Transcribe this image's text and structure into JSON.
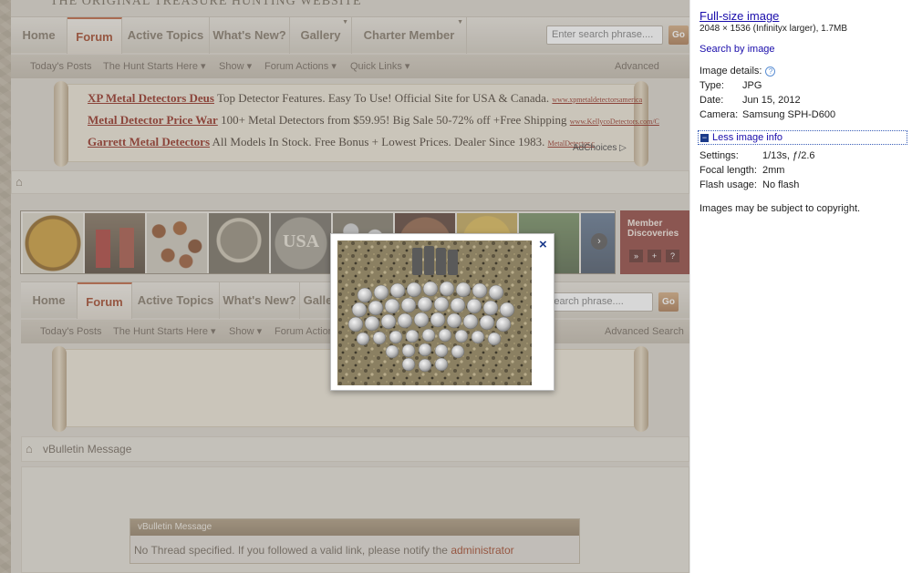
{
  "forum": {
    "tagline": "THE ORIGINAL TREASURE HUNTING WEBSITE",
    "nav_tabs": [
      "Home",
      "Forum",
      "Active Topics",
      "What's New?",
      "Gallery",
      "Charter Member"
    ],
    "nav_tabs_lower": [
      "Home",
      "Forum",
      "Active Topics",
      "What's New?",
      "Galle"
    ],
    "search_placeholder": "Enter search phrase....",
    "search_placeholder_lower": "er search phrase....",
    "go_label": "Go",
    "subnav": [
      "Today's Posts",
      "The Hunt Starts Here ▾",
      "Show ▾",
      "Forum Actions ▾",
      "Quick Links ▾"
    ],
    "subnav_lower": [
      "Today's Posts",
      "The Hunt Starts Here ▾",
      "Show ▾",
      "Forum Action"
    ],
    "advanced_search": "Advanced Search",
    "advanced_search_top": "Advanced Search",
    "ads": [
      {
        "title": "XP Metal Detectors Deus",
        "text": " Top Detector Features. Easy To Use! Official Site for USA & Canada. ",
        "url": "www.xpmetaldetectorsamerica"
      },
      {
        "title": "Metal Detector Price War",
        "text": " 100+ Metal Detectors from $59.95! Big Sale 50-72% off +Free Shipping ",
        "url": "www.KellycoDetectors.com/C"
      },
      {
        "title": "Garrett Metal Detectors",
        "text": " All Models In Stock. Free Bonus + Lowest Prices. Dealer Since 1983. ",
        "url": "MetalDetector.c"
      }
    ],
    "adchoices": "AdChoices ▷",
    "member_box": "Member Discoveries",
    "member_buttons": [
      "»",
      "+",
      "?"
    ],
    "strip_arrow": "›",
    "message_title": "vBulletin Message",
    "message_panel_title": "vBulletin Message",
    "message_text": "No Thread specified. If you followed a valid link, please notify the ",
    "message_link": "administrator"
  },
  "popup": {
    "close": "×"
  },
  "info": {
    "full_size_link": "Full-size image",
    "dimensions": "2048 × 1536 (Infinityx larger), 1.7MB",
    "search_by_image": "Search by image",
    "details_label": "Image details:",
    "help_icon": "?",
    "type_label": "Type:",
    "type_value": "JPG",
    "date_label": "Date:",
    "date_value": "Jun 15, 2012",
    "camera_label": "Camera:",
    "camera_value": "Samsung SPH-D600",
    "less_info": "Less image info",
    "less_box": "−",
    "settings_label": "Settings:",
    "settings_value": "1/13s, ƒ/2.6",
    "focal_label": "Focal length:",
    "focal_value": "2mm",
    "flash_label": "Flash usage:",
    "flash_value": "No flash",
    "copyright": "Images may be subject to copyright."
  },
  "colors": {
    "link": "#1a0dab",
    "forum_accent": "#9b3a1a",
    "close_button": "#1a3a8a"
  }
}
